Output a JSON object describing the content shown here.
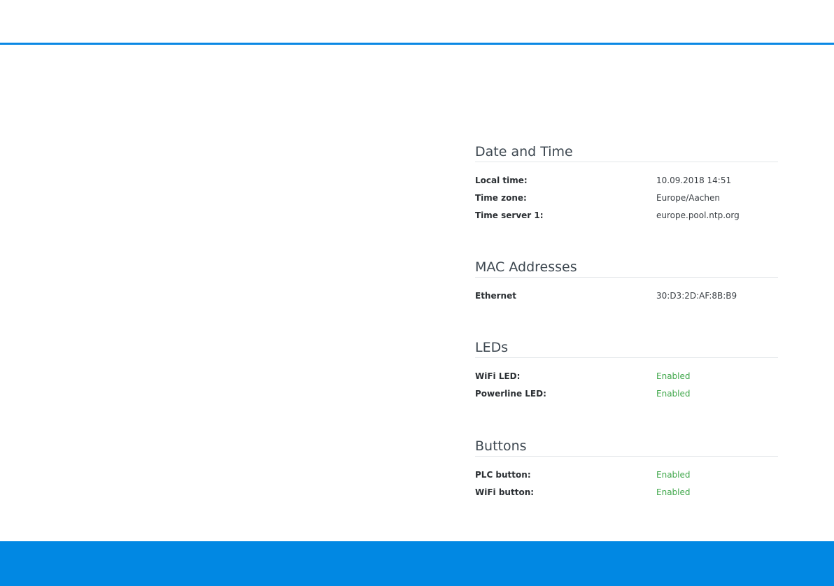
{
  "colors": {
    "accent": "#0a88e4",
    "footer": "#0188e3",
    "enabled": "#3fa74a"
  },
  "date_time": {
    "title": "Date and Time",
    "rows": [
      {
        "label": "Local time:",
        "value": "10.09.2018 14:51"
      },
      {
        "label": "Time zone:",
        "value": "Europe/Aachen"
      },
      {
        "label": "Time server 1:",
        "value": "europe.pool.ntp.org"
      }
    ]
  },
  "mac_addresses": {
    "title": "MAC Addresses",
    "rows": [
      {
        "label": "Ethernet",
        "value": "30:D3:2D:AF:8B:B9"
      }
    ]
  },
  "leds": {
    "title": "LEDs",
    "rows": [
      {
        "label": "WiFi LED:",
        "value": "Enabled"
      },
      {
        "label": "Powerline LED:",
        "value": "Enabled"
      }
    ]
  },
  "buttons": {
    "title": "Buttons",
    "rows": [
      {
        "label": "PLC button:",
        "value": "Enabled"
      },
      {
        "label": "WiFi button:",
        "value": "Enabled"
      }
    ]
  }
}
